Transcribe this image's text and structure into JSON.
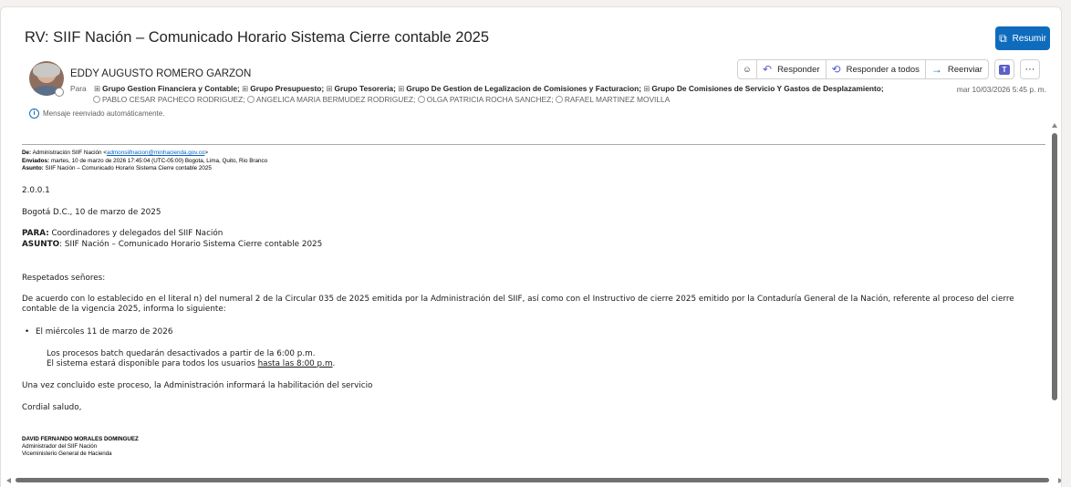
{
  "header": {
    "subject": "RV: SIIF Nación – Comunicado Horario Sistema Cierre contable 2025",
    "summarize_label": "Resumir",
    "sender": "EDDY AUGUSTO ROMERO GARZON",
    "to_label": "Para",
    "to_groups": [
      "Grupo Gestion Financiera y Contable;",
      "Grupo Presupuesto;",
      "Grupo Tesoreria;",
      "Grupo De Gestion de Legalizacion de Comisiones y Facturacion;",
      "Grupo De Comisiones de Servicio Y Gastos de Desplazamiento;"
    ],
    "to_people": [
      "PABLO CESAR PACHECO RODRIGUEZ;",
      "ANGELICA MARIA BERMUDEZ RODRIGUEZ;",
      "OLGA PATRICIA ROCHA SANCHEZ;",
      "RAFAEL MARTINEZ MOVILLA"
    ],
    "date": "mar 10/03/2026 5:45 p. m.",
    "auto_forward_note": "Mensaje reenviado automáticamente."
  },
  "toolbar": {
    "reply": "Responder",
    "reply_all": "Responder a todos",
    "forward": "Reenviar"
  },
  "body": {
    "from_label": "De:",
    "from_value": "Administración SIIF Nación <",
    "from_email": "admonsiifnacion@minhacienda.gov.co",
    "from_end": ">",
    "sent_label": "Enviados:",
    "sent_value": "martes, 10 de marzo de 2026 17:45:04 (UTC-05:00) Bogota, Lima, Quito, Rio Branco",
    "subject_label": "Asunto:",
    "subject_value": "SIIF Nación – Comunicado Horario Sistema Cierre contable 2025",
    "code": "2.0.0.1",
    "place_date": "Bogotá D.C., 10 de marzo de 2025",
    "para_label": "PARA:",
    "para_value": "Coordinadores y delegados del SIIF Nación",
    "asunto_label": "ASUNTO",
    "asunto_value": ": SIIF Nación – Comunicado Horario Sistema Cierre contable 2025",
    "greeting": "Respetados señores:",
    "paragraph": "De acuerdo con lo establecido en el literal n) del numeral 2 de la Circular 035 de 2025 emitida por la Administración del SIIF, así como con el Instructivo de cierre 2025 emitido por la Contaduría General de la Nación, referente al proceso del cierre contable de la vigencia 2025, informa lo siguiente:",
    "bullet": "El miércoles 11 de marzo de 2026",
    "line1": "Los procesos batch quedarán desactivados a partir de la 6:00 p.m.",
    "line2_pre": "El sistema estará disponible para todos los usuarios ",
    "line2_link": "hasta las 8:00 p.m",
    "line2_end": ".",
    "closing_note": "Una vez concluido este proceso, la Administración informará la habilitación del servicio",
    "regards": "Cordial saludo,",
    "sig_name": "DAVID FERNANDO MORALES DOMINGUEZ",
    "sig_title": "Administrador del SIIF Nación",
    "sig_org": "Viceministerio General de Hacienda"
  },
  "colors": {
    "accent": "#0f6cbd",
    "teams": "#5b5fc7"
  }
}
